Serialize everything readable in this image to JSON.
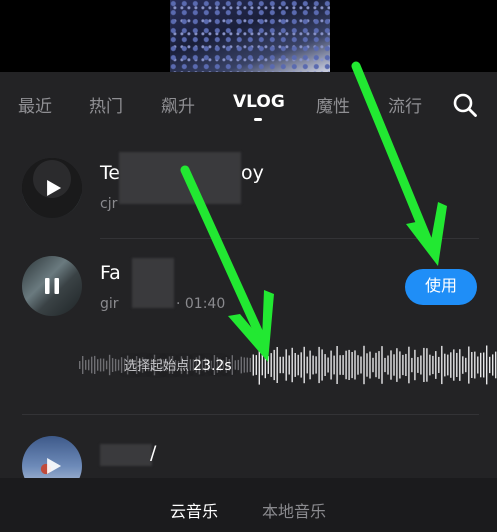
{
  "tabs": [
    {
      "label": "最近",
      "active": false
    },
    {
      "label": "热门",
      "active": false
    },
    {
      "label": "飙升",
      "active": false
    },
    {
      "label": "VLOG",
      "active": true
    },
    {
      "label": "魔性",
      "active": false
    },
    {
      "label": "流行",
      "active": false
    }
  ],
  "icons": {
    "search": "search-icon",
    "play": "play-icon",
    "pause": "pause-icon"
  },
  "tracks": [
    {
      "title_prefix": "Te",
      "title_suffix": "oy",
      "artist_prefix": "cjr",
      "state": "paused"
    },
    {
      "title_prefix": "Fa",
      "artist_prefix": "gir",
      "duration": "· 01:40",
      "state": "playing",
      "use_label": "使用"
    },
    {
      "title_suffix": "/",
      "state": "paused"
    }
  ],
  "waveform": {
    "label": "选择起始点",
    "time": "23.2s"
  },
  "bottom_nav": {
    "cloud_music": "云音乐",
    "local_music": "本地音乐",
    "active": "cloud_music"
  },
  "colors": {
    "panel_bg": "#232325",
    "accent_blue": "#1f8ef7",
    "annotation_green": "#22e832",
    "tab_inactive": "#8f8f93"
  }
}
